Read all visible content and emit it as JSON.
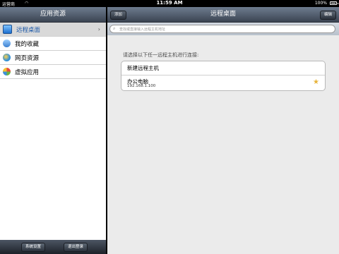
{
  "statusbar": {
    "carrier": "运营商",
    "time": "11:59 AM",
    "battery": "100%"
  },
  "left": {
    "title": "应用资源",
    "items": [
      {
        "label": "远程桌面",
        "icon": "remote-desktop-icon",
        "selected": true
      },
      {
        "label": "我的收藏",
        "icon": "favorites-icon",
        "selected": false
      },
      {
        "label": "网页资源",
        "icon": "web-resource-icon",
        "selected": false
      },
      {
        "label": "虚拟应用",
        "icon": "virtual-app-icon",
        "selected": false
      }
    ],
    "toolbar": {
      "settings": "系统设置",
      "logout": "退出登录"
    }
  },
  "right": {
    "title": "远程桌面",
    "add_button": "添加",
    "edit_button": "编辑",
    "search_placeholder": "查找或直接输入远程主机地址",
    "prompt": "请选择以下任一远程主机进行连接:",
    "new_host": "新建远程主机",
    "host": {
      "name": "办公电脑",
      "ip": "192.168.1.100"
    }
  },
  "colors": {
    "accent": "#1f5aa8",
    "star": "#e8b43a"
  }
}
